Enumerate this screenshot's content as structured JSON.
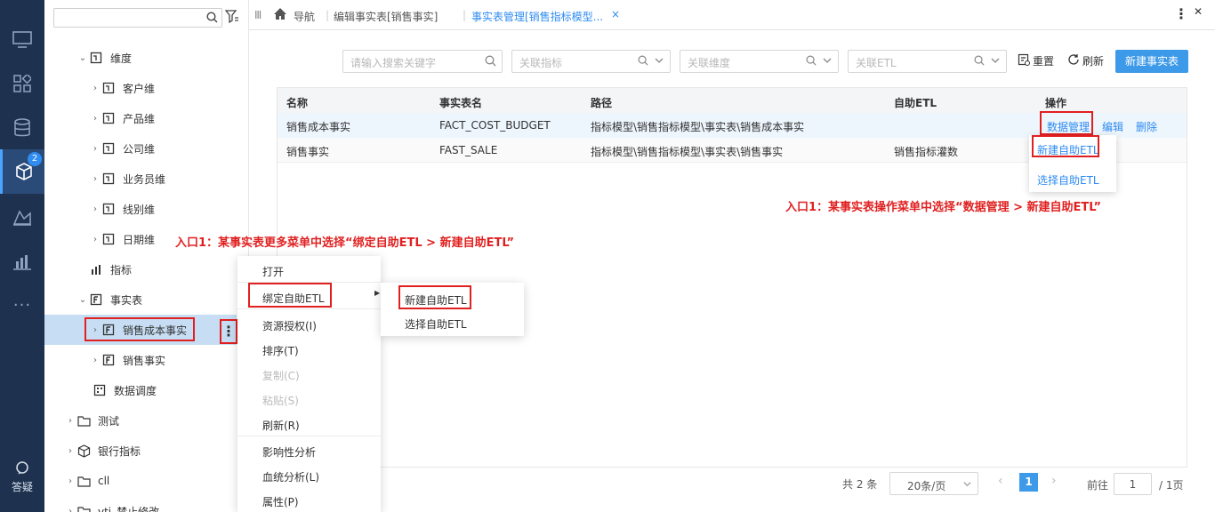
{
  "rail": {
    "badge": "2",
    "help_label": "答疑"
  },
  "tree": {
    "search_placeholder": "",
    "items": [
      {
        "label": "维度"
      },
      {
        "label": "客户维"
      },
      {
        "label": "产品维"
      },
      {
        "label": "公司维"
      },
      {
        "label": "业务员维"
      },
      {
        "label": "线别维"
      },
      {
        "label": "日期维"
      },
      {
        "label": "指标"
      },
      {
        "label": "事实表"
      },
      {
        "label": "销售成本事实"
      },
      {
        "label": "销售事实"
      },
      {
        "label": "数据调度"
      },
      {
        "label": "测试"
      },
      {
        "label": "银行指标"
      },
      {
        "label": "cll"
      },
      {
        "label": "vti_禁止修改"
      }
    ]
  },
  "tabs": {
    "nav": "导航",
    "edit_tab": "编辑事实表[销售事实]",
    "active_tab": "事实表管理[销售指标模型...",
    "close": "×"
  },
  "toolbar": {
    "search_placeholder": "请输入搜索关键字",
    "metric_placeholder": "关联指标",
    "dimension_placeholder": "关联维度",
    "etl_placeholder": "关联ETL",
    "reset": "重置",
    "refresh": "刷新",
    "new_fact": "新建事实表"
  },
  "table": {
    "headers": [
      "名称",
      "事实表名",
      "路径",
      "自助ETL",
      "操作"
    ],
    "rows": [
      {
        "name": "销售成本事实",
        "table": "FACT_COST_BUDGET",
        "path": "指标模型\\销售指标模型\\事实表\\销售成本事实",
        "etl": ""
      },
      {
        "name": "销售事实",
        "table": "FAST_SALE",
        "path": "指标模型\\销售指标模型\\事实表\\销售事实",
        "etl": "销售指标灌数"
      }
    ],
    "actions": {
      "data_mgmt": "数据管理",
      "edit": "编辑",
      "delete": "删除"
    }
  },
  "data_mgmt_menu": [
    "新建自助ETL",
    "选择自助ETL"
  ],
  "context_menu": {
    "items": [
      "打开",
      "绑定自助ETL",
      "资源授权(I)",
      "排序(T)",
      "复制(C)",
      "粘贴(S)",
      "刷新(R)",
      "影响性分析",
      "血统分析(L)",
      "属性(P)"
    ],
    "submenu": [
      "新建自助ETL",
      "选择自助ETL"
    ]
  },
  "annotations": {
    "note_right": "入口1：某事实表操作菜单中选择“数据管理 > 新建自助ETL”",
    "note_left": "入口1：某事实表更多菜单中选择“绑定自助ETL > 新建自助ETL”"
  },
  "pager": {
    "total": "共 2 条",
    "page_size": "20条/页",
    "current_page": "1",
    "goto_label": "前往",
    "goto_value": "1",
    "total_pages": "/ 1页"
  }
}
